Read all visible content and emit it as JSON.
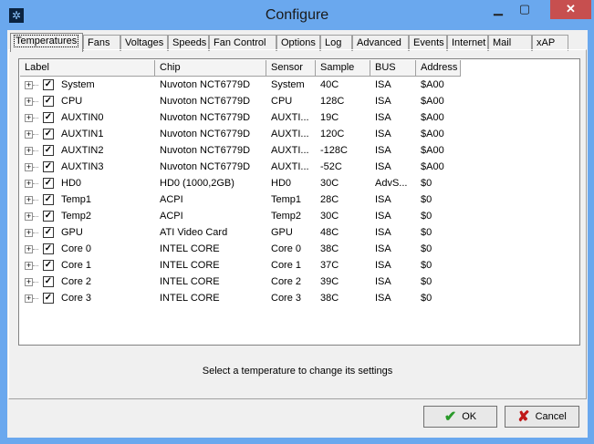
{
  "window": {
    "title": "Configure"
  },
  "tabs": [
    "Temperatures",
    "Fans",
    "Voltages",
    "Speeds",
    "Fan Control",
    "Options",
    "Log",
    "Advanced",
    "Events",
    "Internet",
    "Mail",
    "xAP"
  ],
  "columns": [
    "Label",
    "Chip",
    "Sensor",
    "Sample",
    "BUS",
    "Address"
  ],
  "rows": [
    [
      "System",
      "Nuvoton NCT6779D",
      "System",
      "40C",
      "ISA",
      "$A00"
    ],
    [
      "CPU",
      "Nuvoton NCT6779D",
      "CPU",
      "128C",
      "ISA",
      "$A00"
    ],
    [
      "AUXTIN0",
      "Nuvoton NCT6779D",
      "AUXTI...",
      "19C",
      "ISA",
      "$A00"
    ],
    [
      "AUXTIN1",
      "Nuvoton NCT6779D",
      "AUXTI...",
      "120C",
      "ISA",
      "$A00"
    ],
    [
      "AUXTIN2",
      "Nuvoton NCT6779D",
      "AUXTI...",
      "-128C",
      "ISA",
      "$A00"
    ],
    [
      "AUXTIN3",
      "Nuvoton NCT6779D",
      "AUXTI...",
      "-52C",
      "ISA",
      "$A00"
    ],
    [
      "HD0",
      "HD0 (1000,2GB)",
      "HD0",
      "30C",
      "AdvS...",
      "$0"
    ],
    [
      "Temp1",
      "ACPI",
      "Temp1",
      "28C",
      "ISA",
      "$0"
    ],
    [
      "Temp2",
      "ACPI",
      "Temp2",
      "30C",
      "ISA",
      "$0"
    ],
    [
      "GPU",
      "ATI Video Card",
      "GPU",
      "48C",
      "ISA",
      "$0"
    ],
    [
      "Core 0",
      "INTEL CORE",
      "Core 0",
      "38C",
      "ISA",
      "$0"
    ],
    [
      "Core 1",
      "INTEL CORE",
      "Core 1",
      "37C",
      "ISA",
      "$0"
    ],
    [
      "Core 2",
      "INTEL CORE",
      "Core 2",
      "39C",
      "ISA",
      "$0"
    ],
    [
      "Core 3",
      "INTEL CORE",
      "Core 3",
      "38C",
      "ISA",
      "$0"
    ]
  ],
  "message": "Select a temperature to change its settings",
  "buttons": {
    "ok": "OK",
    "cancel": "Cancel"
  }
}
